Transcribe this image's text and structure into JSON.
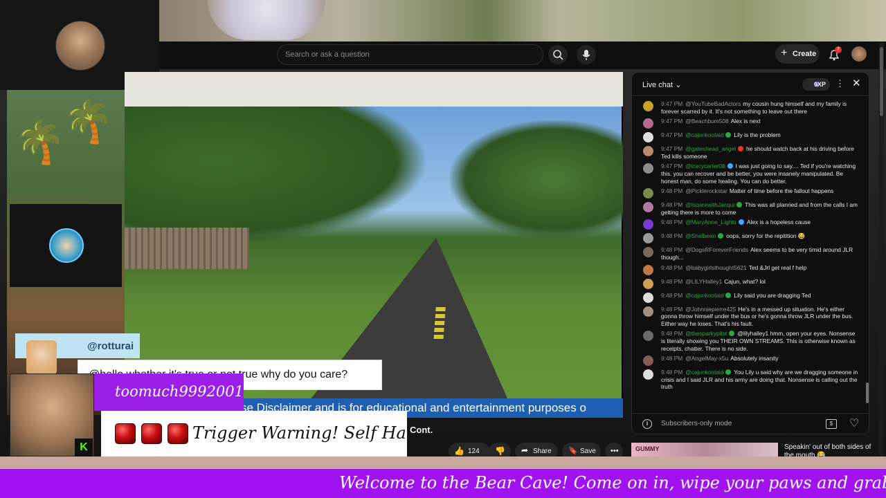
{
  "youtube": {
    "search_placeholder": "Search or ask a question",
    "create_label": "Create",
    "notification_count": "7"
  },
  "video": {
    "comment_user": "@rotturai",
    "comment_text": "@hello whether it's true or not true why do you care?",
    "disclaimer": "se Disclaimer and is for educational and entertainment purposes o",
    "title_fragment": "Cont.",
    "like_count": "124",
    "share_label": "Share",
    "save_label": "Save"
  },
  "overlay": {
    "username": "toomuch9992001",
    "warning": "Trigger Warning! Self Harm",
    "kick_badge": "K",
    "ticker": "Welcome to the Bear Cave! Come on in, wipe your paws and grab a rocking"
  },
  "chat": {
    "title": "Live chat",
    "xp_label": "0XP",
    "footer_text": "Subscribers-only mode",
    "messages": [
      {
        "time": "9:47 PM",
        "author": "@YouTubeBadActors",
        "text": "my cousin hung himself and my family is forever scarred by it. It's not something to leave out there",
        "member": false,
        "badge": "",
        "avatar": "#c9a227"
      },
      {
        "time": "9:47 PM",
        "author": "@Beachbum508",
        "text": "Alex is next",
        "member": false,
        "badge": "",
        "avatar": "#b46a8a"
      },
      {
        "time": "9:47 PM",
        "author": "@cajunkoolaid",
        "text": "Lily is the problem",
        "member": true,
        "badge": "green",
        "avatar": "#dddddd"
      },
      {
        "time": "9:47 PM",
        "author": "@gateshead_angel",
        "text": "he should watch back at his driving before Ted kills someone",
        "member": true,
        "badge": "red",
        "avatar": "#b98a6a"
      },
      {
        "time": "9:47 PM",
        "author": "@tracycarter08",
        "text": "I was just going to say.... Ted if you're watching this. you can recover and be better, you were insanely manipulated. Be honest man, do some healing. You can do better.",
        "member": true,
        "badge": "blue",
        "avatar": "#8c8c8c"
      },
      {
        "time": "9:48 PM",
        "author": "@Picklerockstar",
        "text": "Matter of time before the fallout happens",
        "member": false,
        "badge": "",
        "avatar": "#7a8c4a"
      },
      {
        "time": "9:48 PM",
        "author": "@IsoarewithJacqui",
        "text": "This was all planned and from the calls I am getting there is more to come",
        "member": true,
        "badge": "green",
        "avatar": "#b07aa0"
      },
      {
        "time": "9:48 PM",
        "author": "@MaryAnne_Lights",
        "text": "Alex is a hopeless cause",
        "member": true,
        "badge": "blue",
        "avatar": "#7a3ad0"
      },
      {
        "time": "9:48 PM",
        "author": "@Shelbeen",
        "text": "oops, sorry for the repitition 😂",
        "member": true,
        "badge": "green",
        "avatar": "#9a9a9a"
      },
      {
        "time": "9:48 PM",
        "author": "@DogsRForeverFriends",
        "text": "Alex seems to be very timid around JLR though...",
        "member": false,
        "badge": "",
        "avatar": "#7a6a5a"
      },
      {
        "time": "9:48 PM",
        "author": "@babygirlsthought5621",
        "text": "Ted &Jrl get real f help",
        "member": false,
        "badge": "",
        "avatar": "#c07a4a"
      },
      {
        "time": "9:48 PM",
        "author": "@LILYHalley1",
        "text": "Cajun, what? lol",
        "member": false,
        "badge": "",
        "avatar": "#d0a050"
      },
      {
        "time": "9:48 PM",
        "author": "@cajunkoolaid",
        "text": "Lily said you are dragging Ted",
        "member": true,
        "badge": "green",
        "avatar": "#dddddd"
      },
      {
        "time": "9:48 PM",
        "author": "@Johnniepierre425",
        "text": "He's in a messed up situation. He's either gonna throw himself under the bus or he's gonna throw JLR under the bus. Either way he loses. That's his fault.",
        "member": false,
        "badge": "",
        "avatar": "#a09080"
      },
      {
        "time": "9:48 PM",
        "author": "@thesparkypilot",
        "text": "@lilyhalley1 hmm, open your eyes. Nonsense is literally showing you THEIR OWN STREAMS. This is otherwise known as receipts, chatter. There is no side.",
        "member": true,
        "badge": "green",
        "avatar": "#6a6a6a"
      },
      {
        "time": "9:48 PM",
        "author": "@AngelMay-x5u",
        "text": "Absolutely insanity",
        "member": false,
        "badge": "",
        "avatar": "#8a5a5a"
      },
      {
        "time": "9:48 PM",
        "author": "@cajunkoolaid",
        "text": "You Lily u said why are we dragging someone in crisis and I said JLR and his army are doing that. Nonsense is calling out the truth",
        "member": true,
        "badge": "green",
        "avatar": "#dddddd"
      }
    ]
  },
  "related": {
    "title": "Speakin' out of both sides of the mouth 😂",
    "thumb_text": "GUMMY"
  }
}
